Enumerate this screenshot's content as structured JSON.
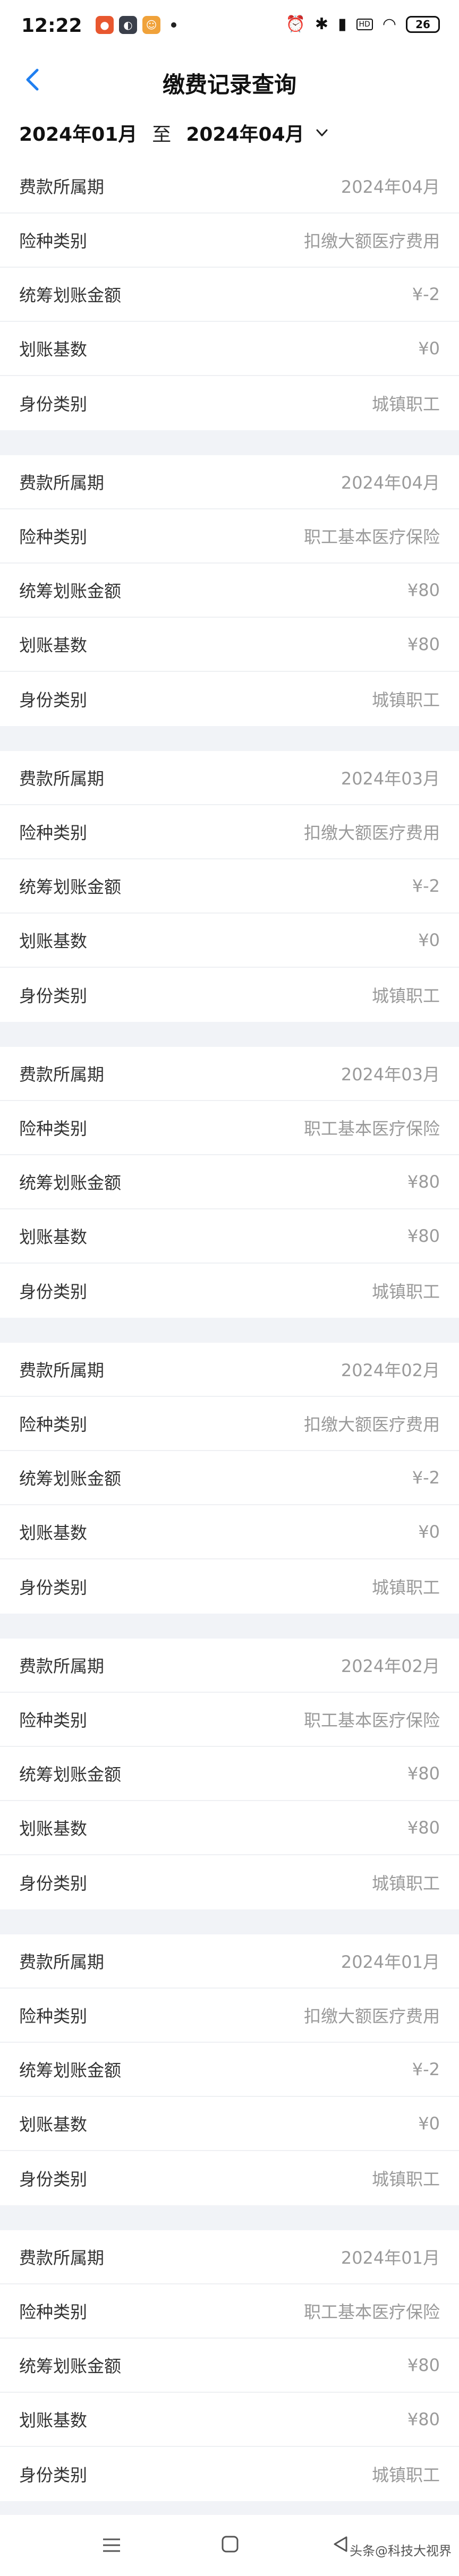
{
  "status_bar": {
    "time": "12:22",
    "battery": "26",
    "hd_label": "HD",
    "app_icons": [
      "app-icon-1",
      "app-icon-2",
      "app-icon-3",
      "app-icon-4"
    ]
  },
  "nav": {
    "title": "缴费记录查询"
  },
  "filter": {
    "start": "2024年01月",
    "separator": "至",
    "end": "2024年04月"
  },
  "records": [
    {
      "rows": [
        {
          "label": "费款所属期",
          "value": "2024年04月"
        },
        {
          "label": "险种类别",
          "value": "扣缴大额医疗费用"
        },
        {
          "label": "统筹划账金额",
          "value": "¥-2"
        },
        {
          "label": "划账基数",
          "value": "¥0"
        },
        {
          "label": "身份类别",
          "value": "城镇职工"
        }
      ]
    },
    {
      "rows": [
        {
          "label": "费款所属期",
          "value": "2024年04月"
        },
        {
          "label": "险种类别",
          "value": "职工基本医疗保险"
        },
        {
          "label": "统筹划账金额",
          "value": "¥80"
        },
        {
          "label": "划账基数",
          "value": "¥80"
        },
        {
          "label": "身份类别",
          "value": "城镇职工"
        }
      ]
    },
    {
      "rows": [
        {
          "label": "费款所属期",
          "value": "2024年03月"
        },
        {
          "label": "险种类别",
          "value": "扣缴大额医疗费用"
        },
        {
          "label": "统筹划账金额",
          "value": "¥-2"
        },
        {
          "label": "划账基数",
          "value": "¥0"
        },
        {
          "label": "身份类别",
          "value": "城镇职工"
        }
      ]
    },
    {
      "rows": [
        {
          "label": "费款所属期",
          "value": "2024年03月"
        },
        {
          "label": "险种类别",
          "value": "职工基本医疗保险"
        },
        {
          "label": "统筹划账金额",
          "value": "¥80"
        },
        {
          "label": "划账基数",
          "value": "¥80"
        },
        {
          "label": "身份类别",
          "value": "城镇职工"
        }
      ]
    },
    {
      "rows": [
        {
          "label": "费款所属期",
          "value": "2024年02月"
        },
        {
          "label": "险种类别",
          "value": "扣缴大额医疗费用"
        },
        {
          "label": "统筹划账金额",
          "value": "¥-2"
        },
        {
          "label": "划账基数",
          "value": "¥0"
        },
        {
          "label": "身份类别",
          "value": "城镇职工"
        }
      ]
    },
    {
      "rows": [
        {
          "label": "费款所属期",
          "value": "2024年02月"
        },
        {
          "label": "险种类别",
          "value": "职工基本医疗保险"
        },
        {
          "label": "统筹划账金额",
          "value": "¥80"
        },
        {
          "label": "划账基数",
          "value": "¥80"
        },
        {
          "label": "身份类别",
          "value": "城镇职工"
        }
      ]
    },
    {
      "rows": [
        {
          "label": "费款所属期",
          "value": "2024年01月"
        },
        {
          "label": "险种类别",
          "value": "扣缴大额医疗费用"
        },
        {
          "label": "统筹划账金额",
          "value": "¥-2"
        },
        {
          "label": "划账基数",
          "value": "¥0"
        },
        {
          "label": "身份类别",
          "value": "城镇职工"
        }
      ]
    },
    {
      "rows": [
        {
          "label": "费款所属期",
          "value": "2024年01月"
        },
        {
          "label": "险种类别",
          "value": "职工基本医疗保险"
        },
        {
          "label": "统筹划账金额",
          "value": "¥80"
        },
        {
          "label": "划账基数",
          "value": "¥80"
        },
        {
          "label": "身份类别",
          "value": "城镇职工"
        }
      ]
    }
  ],
  "watermark": "头条@科技大视界",
  "colors": {
    "accent": "#1f7ff0",
    "background": "#f1f3f7",
    "value_text": "#9a9a9a"
  }
}
